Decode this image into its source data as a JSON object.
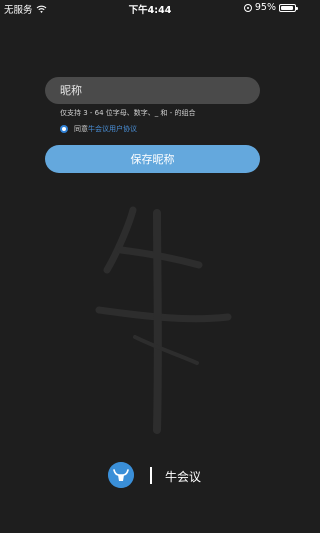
{
  "status_bar": {
    "carrier": "无服务",
    "time": "下午4:44",
    "battery": "95%",
    "battery_level": 0.95
  },
  "form": {
    "nickname_placeholder": "昵称",
    "hint": "仅支持 3 - 64 位字母、数字、_ 和 - 的组合",
    "agree_prefix": "同意",
    "agree_link": "牛会议用户协议",
    "save_label": "保存昵称"
  },
  "footer": {
    "brand_name": "牛会议"
  },
  "colors": {
    "accent": "#64a8dd",
    "link": "#4a90d9",
    "background": "#1e1e1e",
    "input_bg": "#4a4a4a"
  },
  "icons": {
    "wifi": "wifi-icon",
    "lock": "orientation-lock-icon",
    "battery": "battery-icon",
    "logo": "bull-logo-icon",
    "watermark": "niu-character-watermark"
  }
}
